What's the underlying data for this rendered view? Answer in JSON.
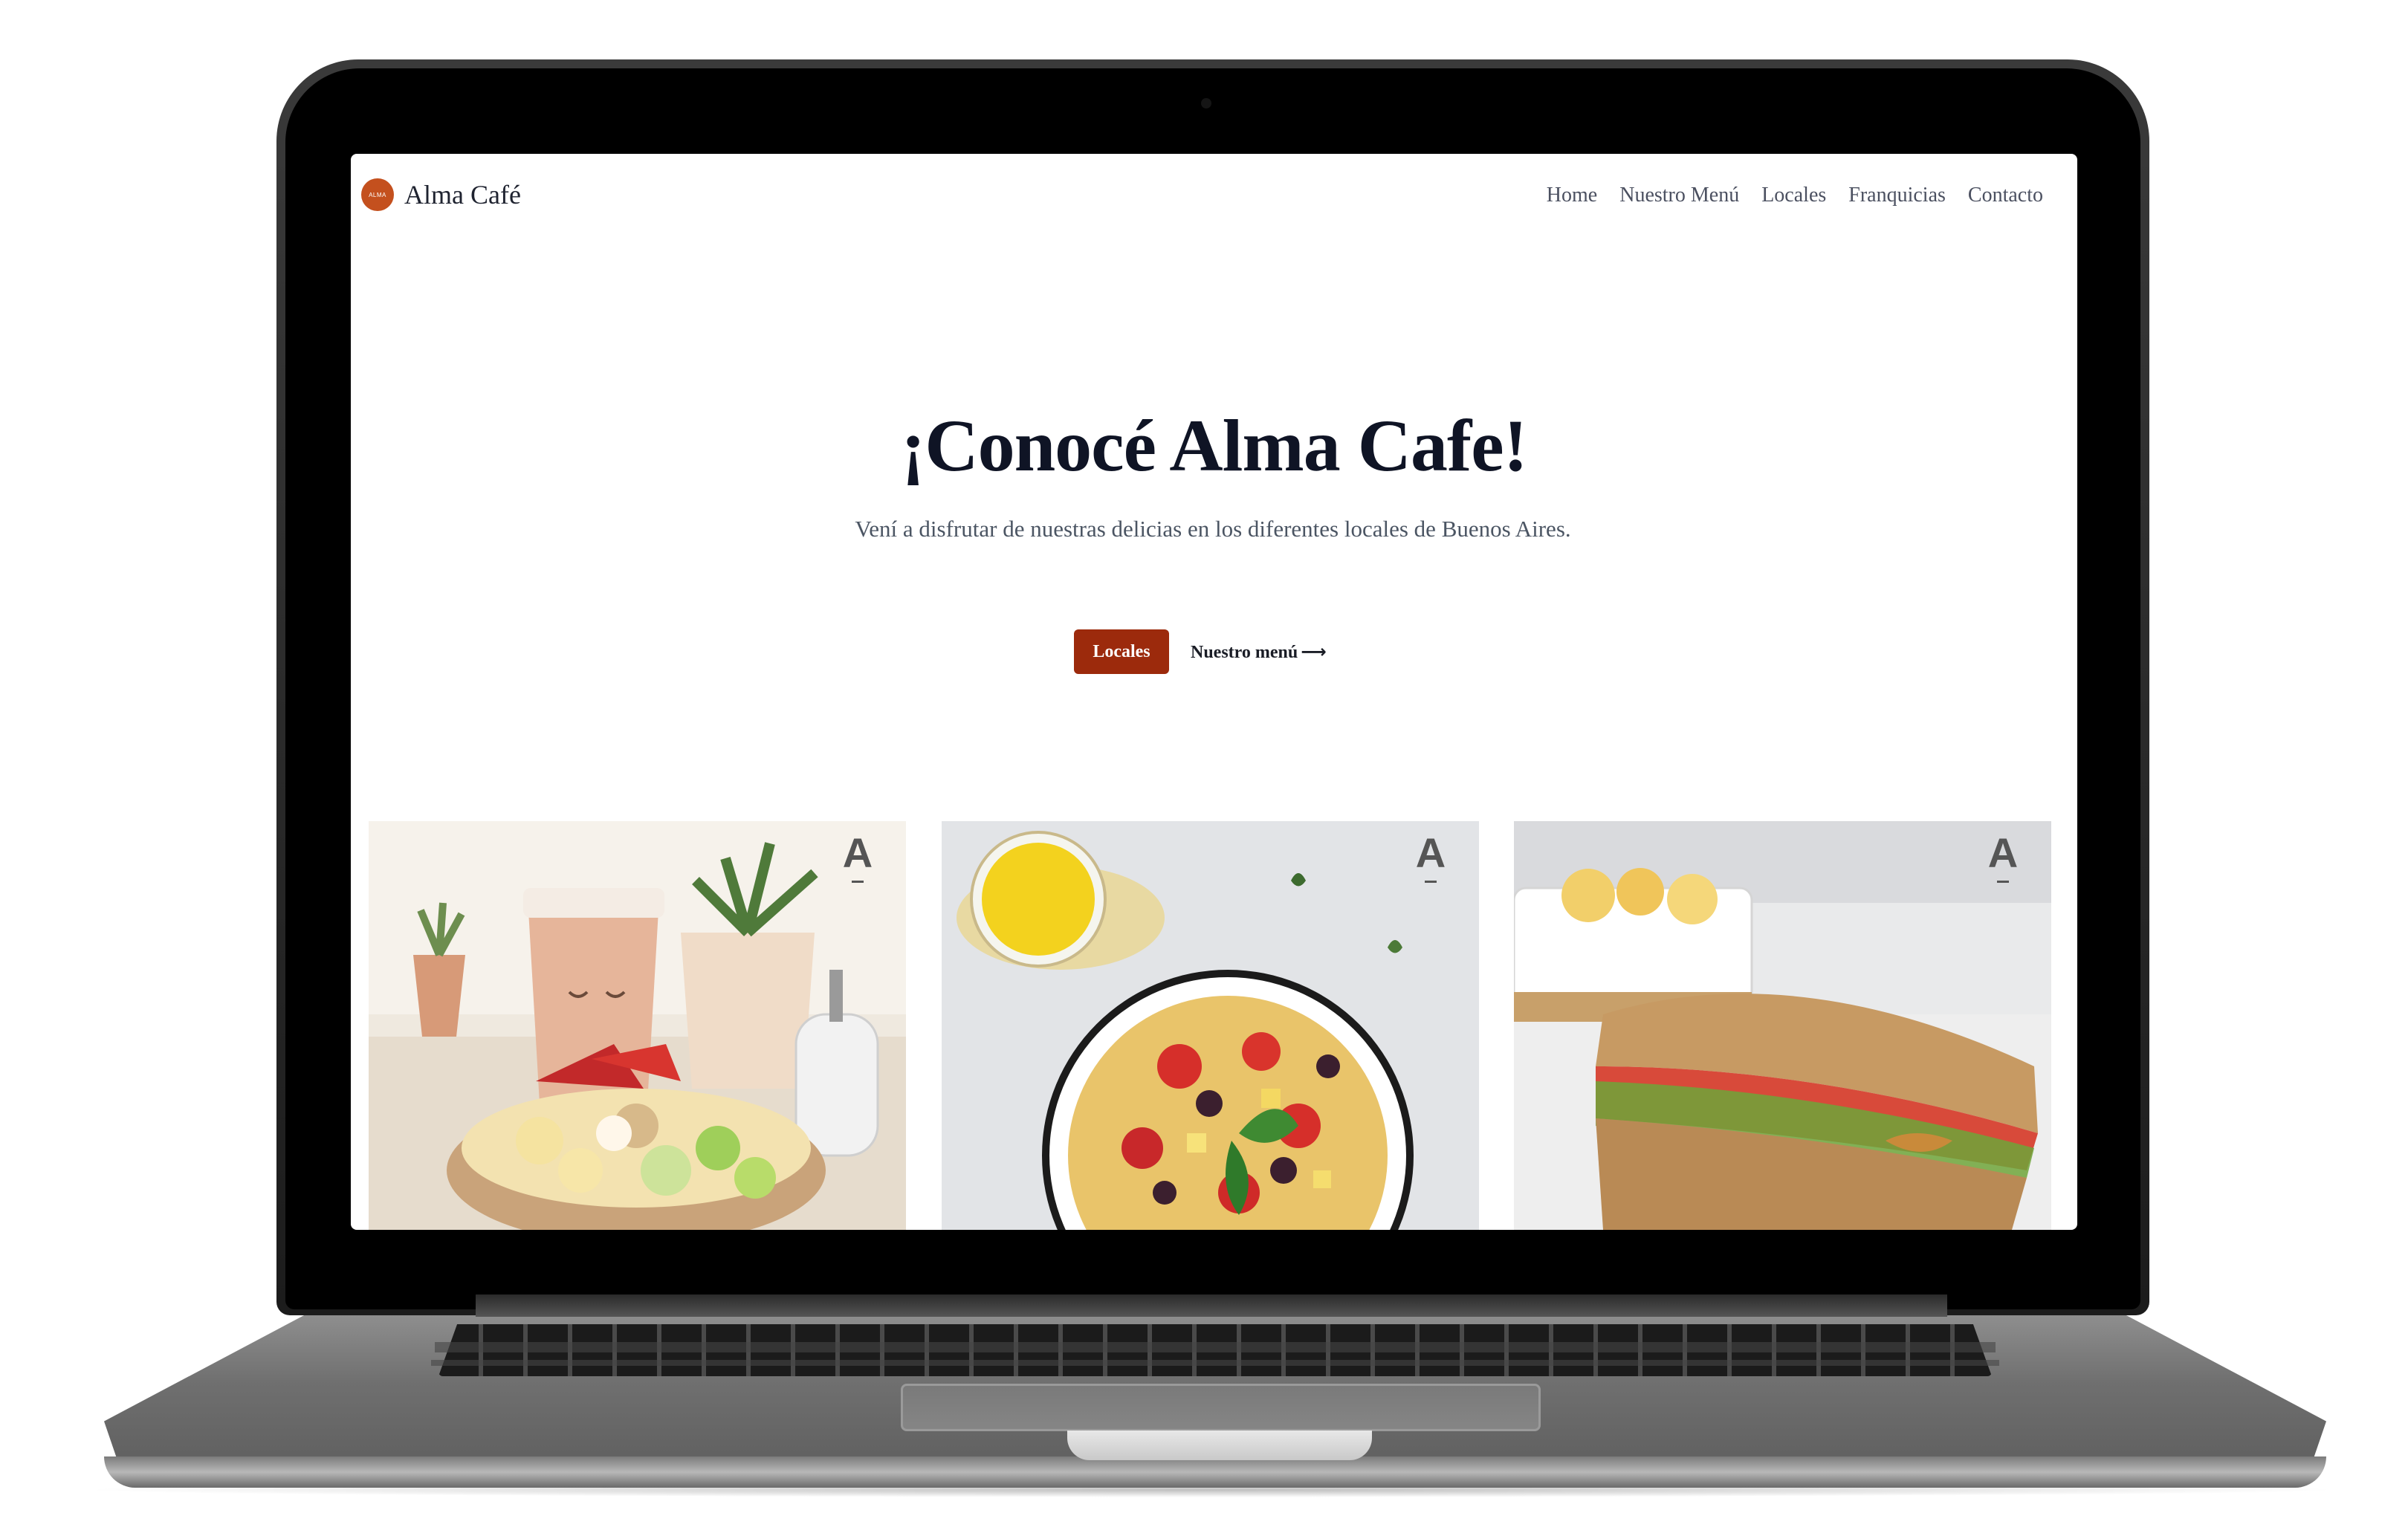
{
  "site": {
    "logo_text": "ALMA",
    "brand_name": "Alma Café",
    "nav": [
      "Home",
      "Nuestro Menú",
      "Locales",
      "Franquicias",
      "Contacto"
    ]
  },
  "hero": {
    "title": "¡Conocé Alma Cafe!",
    "subtitle": "Vení a disfrutar de nuestras delicias en los diferentes locales de Buenos Aires.",
    "primary_button": "Locales",
    "secondary_link": "Nuestro menú"
  },
  "gallery": {
    "badge": "A",
    "images": [
      "fruit-bowl-coffee-photo",
      "pasta-salad-photo",
      "sandwich-photo"
    ]
  },
  "colors": {
    "accent": "#9c2a0c",
    "logo": "#c4501e",
    "heading": "#0f1425"
  }
}
